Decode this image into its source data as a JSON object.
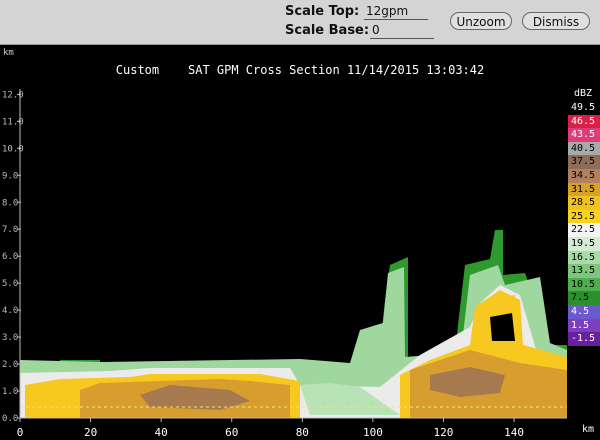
{
  "toolbar": {
    "scale_top_label": "Scale Top:",
    "scale_top_value": "12gpm",
    "scale_base_label": "Scale Base:",
    "scale_base_value": "0",
    "unzoom_label": "Unzoom",
    "dismiss_label": "Dismiss"
  },
  "chart_data": {
    "type": "heatmap",
    "title": "Custom    SAT GPM Cross Section 11/14/2015 13:03:42",
    "xlabel": "km",
    "ylabel": "km",
    "x_ticks": [
      "0",
      "20",
      "40",
      "60",
      "80",
      "100",
      "120",
      "140"
    ],
    "x_tick_values": [
      0,
      20,
      40,
      60,
      80,
      100,
      120,
      140
    ],
    "y_ticks": [
      "0.0",
      "1.0",
      "2.0",
      "3.0",
      "4.0",
      "5.0",
      "6.0",
      "7.0",
      "8.0",
      "9.0",
      "10.0",
      "11.0",
      "12.0"
    ],
    "y_tick_values": [
      0,
      1,
      2,
      3,
      4,
      5,
      6,
      7,
      8,
      9,
      10,
      11,
      12
    ],
    "xlim": [
      0,
      155
    ],
    "ylim": [
      0,
      12.2
    ],
    "colorbar_unit": "dBZ",
    "colorbar_labels": [
      "49.5",
      "46.5",
      "43.5",
      "40.5",
      "37.5",
      "34.5",
      "31.5",
      "28.5",
      "25.5",
      "22.5",
      "19.5",
      "16.5",
      "13.5",
      "10.5",
      "7.5",
      "4.5",
      "1.5",
      "-1.5"
    ],
    "colorbar_colors": [
      "#000000",
      "#d81f4a",
      "#e03c7a",
      "#a9a9a9",
      "#8c6d5a",
      "#b08060",
      "#d7a22a",
      "#f2c21c",
      "#ffd21a",
      "#f4f4f4",
      "#d4ecd4",
      "#a8dba8",
      "#7cc77c",
      "#4db04d",
      "#2b8f2b",
      "#6a5acd",
      "#7b3fbf",
      "#6a1ea0"
    ],
    "colorbar_label_colors": [
      "#ffffff",
      "#ffffff",
      "#ffffff",
      "#000000",
      "#000000",
      "#000000",
      "#000000",
      "#000000",
      "#000000",
      "#000000",
      "#000000",
      "#000000",
      "#000000",
      "#000000",
      "#000000",
      "#ffffff",
      "#ffffff",
      "#ffffff"
    ]
  }
}
